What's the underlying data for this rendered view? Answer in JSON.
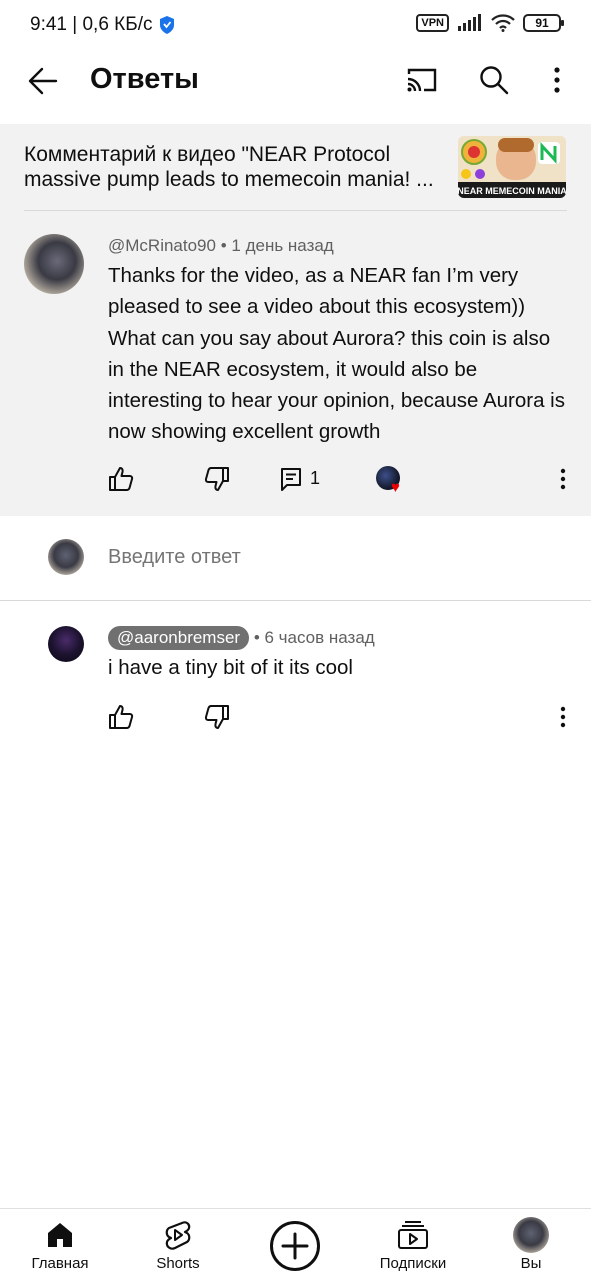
{
  "status_bar": {
    "time_speed": "9:41 | 0,6 КБ/с",
    "vpn": "VPN",
    "battery": "91"
  },
  "app_bar": {
    "title": "Ответы"
  },
  "video_ref": {
    "line1": "Комментарий к видео \"NEAR Protocol",
    "line2": "massive pump leads to memecoin mania! ...",
    "thumb_caption": "NEAR MEMECOIN MANIA"
  },
  "parent_comment": {
    "author": "@McRinato90",
    "time": "1 день назад",
    "text": "Thanks for the video, as a NEAR fan I’m very pleased to see a video about this ecosystem)) What can you say about Aurora? this coin is also in the NEAR ecosystem, it would also be interesting to hear your opinion, because Aurora is now showing excellent growth",
    "reply_count": "1"
  },
  "reply_input": {
    "placeholder": "Введите ответ"
  },
  "reply": {
    "author": "@aaronbremser",
    "time": "6 часов назад",
    "text": "i have a tiny bit of it its cool"
  },
  "bottom_nav": {
    "home": "Главная",
    "shorts": "Shorts",
    "subscriptions": "Подписки",
    "you": "Вы"
  }
}
